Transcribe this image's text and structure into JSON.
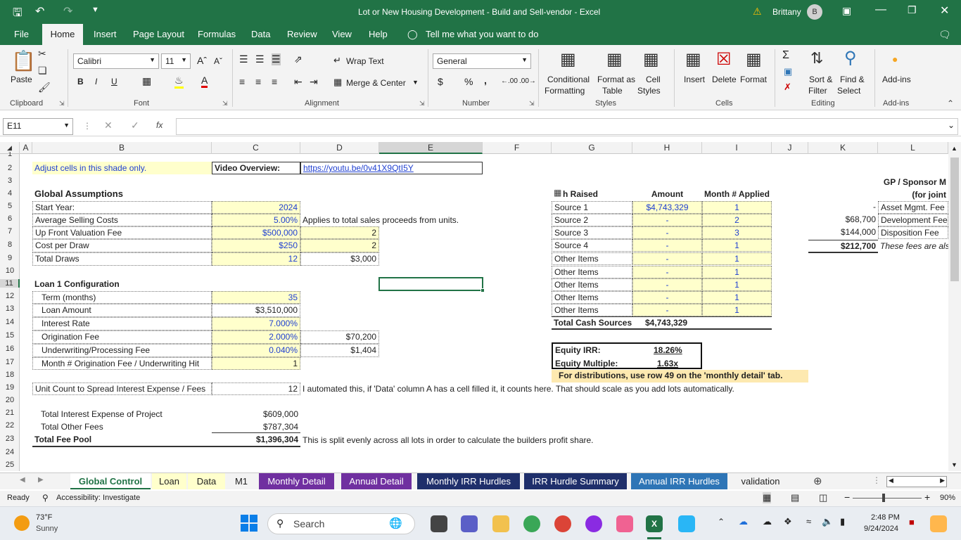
{
  "window": {
    "title": "Lot or New Housing Development - Build and Sell-vendor  -  Excel",
    "warning": "⚠",
    "user": "Brittany",
    "avatar": "B"
  },
  "menu": {
    "items": [
      "File",
      "Home",
      "Insert",
      "Page Layout",
      "Formulas",
      "Data",
      "Review",
      "View",
      "Help"
    ],
    "tell_me": "Tell me what you want to do"
  },
  "ribbon": {
    "clipboard": {
      "label": "Clipboard",
      "paste": "Paste"
    },
    "font": {
      "label": "Font",
      "name": "Calibri",
      "size": "11",
      "bold": "B",
      "italic": "I",
      "underline": "U"
    },
    "alignment": {
      "label": "Alignment",
      "wrap": "Wrap Text",
      "merge": "Merge & Center"
    },
    "number": {
      "label": "Number",
      "format": "General",
      "currency": "$",
      "percent": "%",
      "comma": ","
    },
    "styles": {
      "label": "Styles",
      "conditional": "Conditional",
      "conditional2": "Formatting",
      "format_table": "Format as",
      "format_table2": "Table",
      "cell_styles": "Cell",
      "cell_styles2": "Styles"
    },
    "cells": {
      "label": "Cells",
      "insert": "Insert",
      "delete": "Delete",
      "format": "Format"
    },
    "editing": {
      "label": "Editing",
      "sort": "Sort &",
      "sort2": "Filter",
      "find": "Find &",
      "find2": "Select"
    },
    "addins": {
      "label": "Add-ins",
      "btn": "Add-ins"
    }
  },
  "formula_bar": {
    "name_box": "E11",
    "value": ""
  },
  "columns": [
    "A",
    "B",
    "C",
    "D",
    "E",
    "F",
    "G",
    "H",
    "I",
    "J",
    "K",
    "L"
  ],
  "rows": [
    "1",
    "2",
    "3",
    "4",
    "5",
    "6",
    "7",
    "8",
    "9",
    "10",
    "11",
    "12",
    "13",
    "14",
    "15",
    "16",
    "17",
    "18",
    "19",
    "20",
    "21",
    "22",
    "23",
    "24",
    "25"
  ],
  "cells": {
    "adjust": "Adjust cells in this shade only.",
    "video_label": "Video Overview:",
    "video_link": "https://youtu.be/0v41X9QtI5Y",
    "global_title": "Global Assumptions",
    "start_year_l": "Start Year:",
    "start_year_v": "2024",
    "sell_l": "Average Selling Costs",
    "sell_v": "5.00%",
    "sell_note": "Applies to total sales proceeds from units.",
    "upfront_l": "Up Front Valuation Fee",
    "upfront_v": "$500,000",
    "upfront_d": "2",
    "draw_l": "Cost per Draw",
    "draw_v": "$250",
    "draw_d": "2",
    "draws_l": "Total Draws",
    "draws_v": "12",
    "draws_d": "$3,000",
    "loan_title": "Loan 1 Configuration",
    "term_l": "Term (months)",
    "term_v": "35",
    "amount_l": "Loan Amount",
    "amount_v": "$3,510,000",
    "rate_l": "Interest Rate",
    "rate_v": "7.000%",
    "orig_l": "Origination Fee",
    "orig_v": "2.000%",
    "orig_d": "$70,200",
    "uw_l": "Underwriting/Processing Fee",
    "uw_v": "0.040%",
    "uw_d": "$1,404",
    "month_l": "Month # Origination Fee / Underwriting Hit",
    "month_v": "1",
    "unit_l": "Unit Count to Spread Interest Expense / Fees",
    "unit_v": "12",
    "unit_note": "I automated this, if 'Data' column A has a cell filled it, it counts here. That should scale as you add lots automatically.",
    "tie_l": "Total Interest Expense of Project",
    "tie_v": "$609,000",
    "tof_l": "Total Other Fees",
    "tof_v": "$787,304",
    "tfp_l": "Total Fee Pool",
    "tfp_v": "$1,396,304",
    "tfp_note": "This is split evenly across all lots in order to calculate the builders profit share.",
    "cash_h": "h Raised",
    "amount_h": "Amount",
    "month_h": "Month # Applied",
    "src": [
      [
        "Source 1",
        "$4,743,329",
        "1"
      ],
      [
        "Source 2",
        "-",
        "2"
      ],
      [
        "Source 3",
        "-",
        "3"
      ],
      [
        "Source 4",
        "-",
        "1"
      ],
      [
        "Other Items",
        "-",
        "1"
      ],
      [
        "Other Items",
        "-",
        "1"
      ],
      [
        "Other Items",
        "-",
        "1"
      ],
      [
        "Other Items",
        "-",
        "1"
      ],
      [
        "Other Items",
        "-",
        "1"
      ]
    ],
    "tcs_l": "Total Cash Sources",
    "tcs_v": "$4,743,329",
    "irr_l": "Equity IRR:",
    "irr_v": "18.26%",
    "mult_l": "Equity Multiple:",
    "mult_v": "1.63x",
    "dist_note": "For distributions, use row 49 on the 'monthly detail' tab.",
    "gp_h1": "GP / Sponsor M",
    "gp_h2": "(for joint",
    "fees": [
      [
        "-",
        "Asset Mgmt. Fee"
      ],
      [
        "$68,700",
        "Development Fee"
      ],
      [
        "$144,000",
        "Disposition Fee"
      ]
    ],
    "fees_total": "$212,700",
    "fees_note": "These fees are als"
  },
  "sheets": [
    "Global Control",
    "Loan",
    "Data",
    "M1",
    "Monthly Detail",
    "Annual Detail",
    "Monthly IRR Hurdles",
    "IRR Hurdle Summary",
    "Annual IRR Hurdles",
    "validation"
  ],
  "status": {
    "ready": "Ready",
    "accessibility": "Accessibility: Investigate",
    "zoom": "90%"
  },
  "taskbar": {
    "temp": "73°F",
    "weather": "Sunny",
    "search": "Search",
    "time": "2:48 PM",
    "date": "9/24/2024"
  },
  "colors": {
    "excel_green": "#217346",
    "input_yellow": "#ffffcc",
    "note_orange": "#fde9b0",
    "purple_tab": "#7030a0",
    "navy_tab": "#1f2f6b",
    "blue_tab": "#2e75b6"
  }
}
